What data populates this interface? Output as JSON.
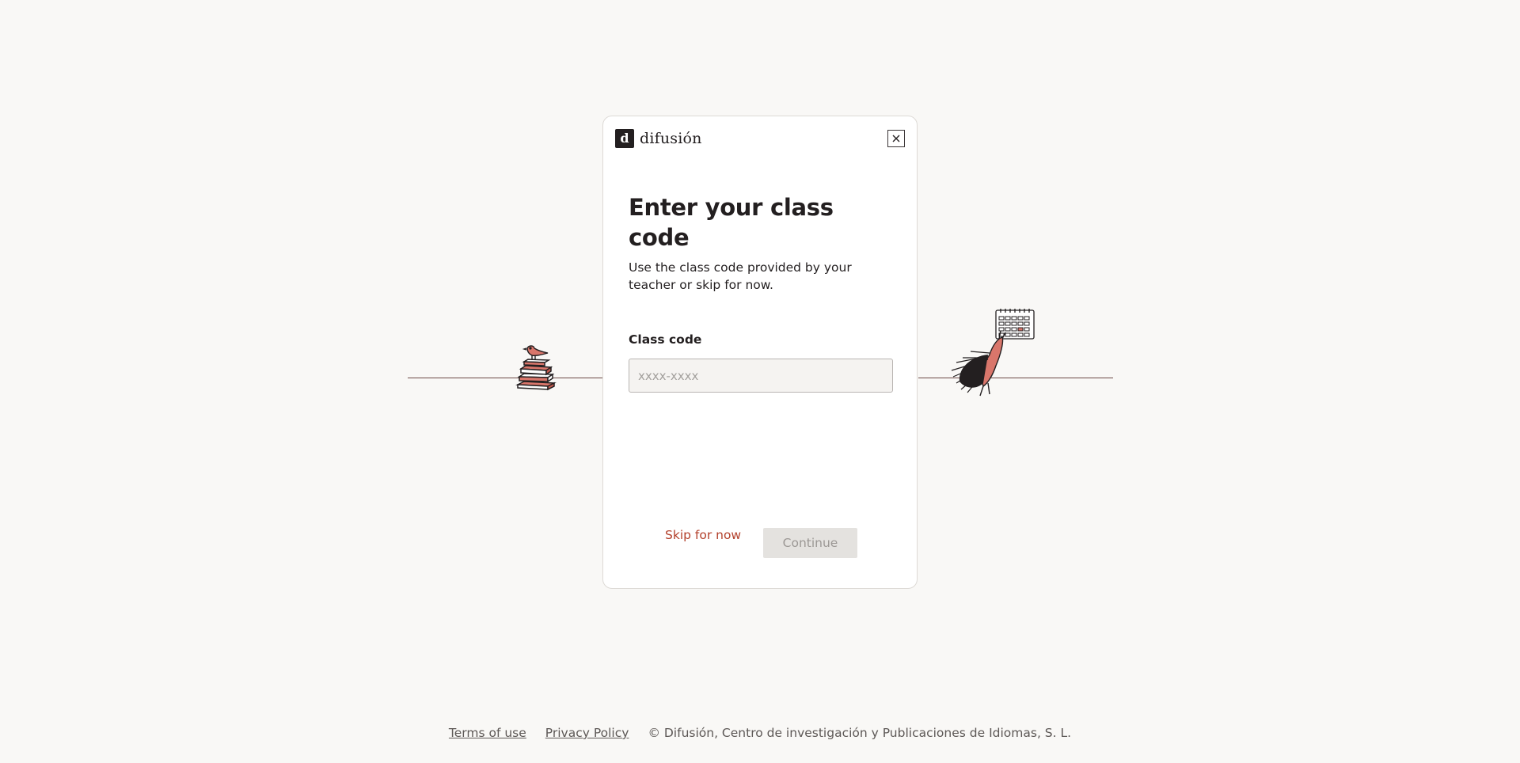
{
  "brand": {
    "name": "difusión",
    "mark": "d"
  },
  "modal": {
    "title": "Enter your class code",
    "subtitle": "Use the class code provided by your teacher or skip for now.",
    "field_label": "Class code",
    "input_placeholder": "xxxx-xxxx",
    "input_value": "",
    "skip_label": "Skip for now",
    "continue_label": "Continue",
    "close_icon": "close-icon"
  },
  "footer": {
    "terms_label": "Terms of use",
    "privacy_label": "Privacy Policy",
    "copyright": "© Difusión, Centro de investigación y Publicaciones de Idiomas, S. L."
  },
  "colors": {
    "background": "#f9f8f6",
    "accent": "#b3412c",
    "text": "#231f20",
    "disabled_button": "#e4e2df"
  }
}
